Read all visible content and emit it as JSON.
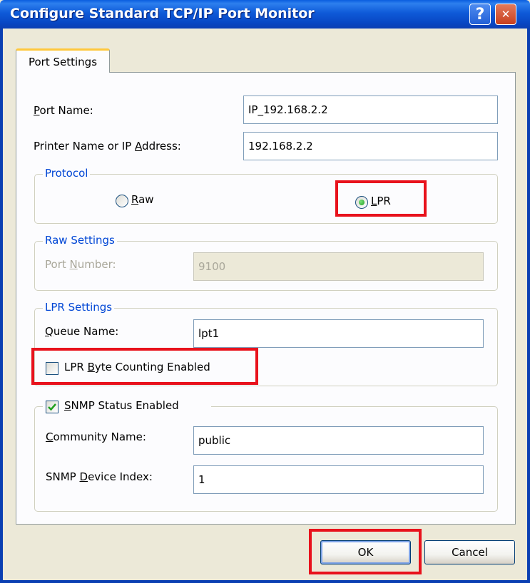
{
  "window": {
    "title": "Configure Standard TCP/IP Port Monitor",
    "help_glyph": "?",
    "close_glyph": "✕"
  },
  "tabs": [
    {
      "label": "Port Settings"
    }
  ],
  "port_name": {
    "label_u": "P",
    "label_rest": "ort Name:",
    "value": "IP_192.168.2.2"
  },
  "printer_address": {
    "label_pre": "Printer Name or IP ",
    "label_u": "A",
    "label_rest": "ddress:",
    "value": "192.168.2.2"
  },
  "protocol": {
    "legend": "Protocol",
    "raw": {
      "label_u": "R",
      "label_rest": "aw",
      "selected": false
    },
    "lpr": {
      "label_u": "L",
      "label_rest": "PR",
      "selected": true
    }
  },
  "raw_settings": {
    "legend": "Raw Settings",
    "port_number": {
      "label_pre": "Port ",
      "label_u": "N",
      "label_rest": "umber:",
      "value": "9100"
    }
  },
  "lpr_settings": {
    "legend": "LPR Settings",
    "queue_name": {
      "label_u": "Q",
      "label_rest": "ueue Name:",
      "value": "lpt1"
    },
    "byte_counting": {
      "label_pre": "LPR ",
      "label_u": "B",
      "label_rest": "yte Counting Enabled",
      "checked": false
    }
  },
  "snmp": {
    "enabled": {
      "label_u": "S",
      "label_rest": "NMP Status Enabled",
      "checked": true
    },
    "community_name": {
      "label_u": "C",
      "label_rest": "ommunity Name:",
      "value": "public"
    },
    "device_index": {
      "label_pre": "SNMP ",
      "label_u": "D",
      "label_rest": "evice Index:",
      "value": "1"
    }
  },
  "buttons": {
    "ok": "OK",
    "cancel": "Cancel"
  },
  "colors": {
    "highlight": "#e8121c",
    "title_bar": "#0a5ee0",
    "group_legend": "#0046d5"
  }
}
